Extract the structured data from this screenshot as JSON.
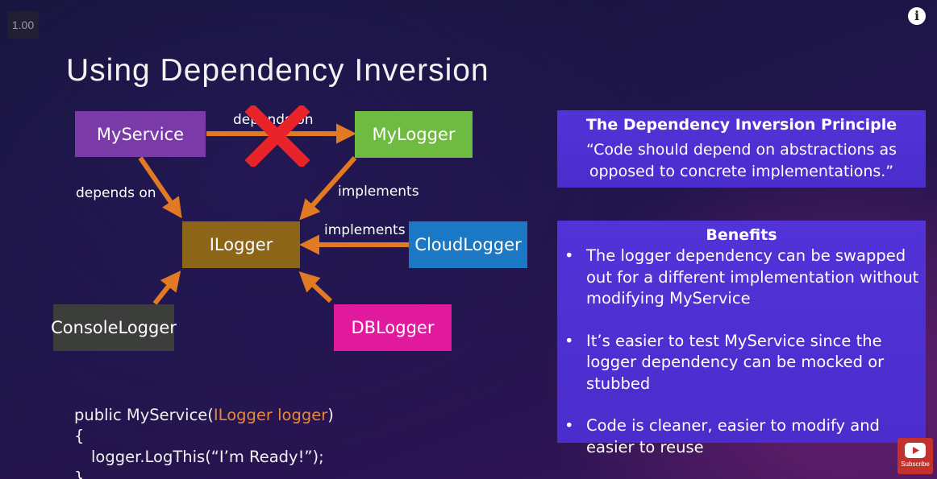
{
  "player": {
    "speed": "1.00",
    "subscribe_label": "Subscribe"
  },
  "slide": {
    "title": "Using Dependency Inversion",
    "diagram": {
      "boxes": {
        "myservice": {
          "label": "MyService",
          "color": "#7a3aa8"
        },
        "mylogger": {
          "label": "MyLogger",
          "color": "#6fba40"
        },
        "ilogger": {
          "label": "ILogger",
          "color": "#8c6518"
        },
        "cloudlogger": {
          "label": "CloudLogger",
          "color": "#1b78c4"
        },
        "consolelogger": {
          "label": "ConsoleLogger",
          "color": "#3c3e3c"
        },
        "dblogger": {
          "label": "DBLogger",
          "color": "#e0199d"
        }
      },
      "edges": {
        "struck_label": "depends on",
        "depends_on": "depends on",
        "implements_mylogger": "implements",
        "implements_cloud": "implements"
      },
      "arrow_color": "#e17a22",
      "cross_color": "#e8232a"
    },
    "principle": {
      "title": "The Dependency Inversion Principle",
      "quote_line1": "“Code should depend on abstractions as",
      "quote_line2": "opposed to concrete implementations.”"
    },
    "benefits": {
      "title": "Benefits",
      "items": [
        "The logger dependency can be swapped out for a different implementation without modifying MyService",
        "It’s easier to test MyService since the logger dependency can be mocked or stubbed",
        "Code is cleaner, easier to modify and easier to reuse"
      ]
    },
    "code": {
      "line1_prefix": "public MyService(",
      "line1_highlight": "ILogger logger",
      "line1_suffix": ")",
      "line2": "{",
      "line3": "logger.LogThis(“I’m Ready!”);",
      "line4": "}"
    }
  },
  "icons": {
    "info": "info-icon",
    "youtube": "youtube-icon",
    "cross": "red-x-icon"
  }
}
